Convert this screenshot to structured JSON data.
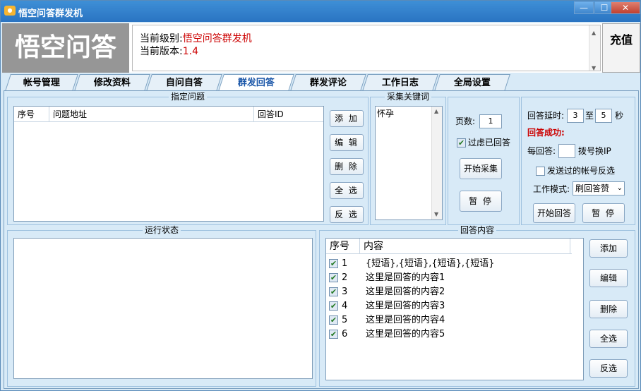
{
  "window": {
    "title": "悟空问答群发机",
    "app_icon": "app-logo-icon",
    "min": "—",
    "max": "☐",
    "close": "✕"
  },
  "header": {
    "logo_text": "悟空问答",
    "level_label": "当前级别:",
    "level_value": "悟空问答群发机",
    "version_label": "当前版本:",
    "version_value": "1.4",
    "recharge_label": "充值"
  },
  "tabs": [
    "帐号管理",
    "修改资料",
    "自问自答",
    "群发回答",
    "群发评论",
    "工作日志",
    "全局设置"
  ],
  "active_tab": "群发回答",
  "question_group": {
    "title": "指定问题",
    "columns": [
      "序号",
      "问题地址",
      "回答ID"
    ],
    "buttons": [
      "添 加",
      "编 辑",
      "删 除",
      "全 选",
      "反 选"
    ]
  },
  "keyword_group": {
    "title": "采集关键词",
    "text": "怀孕"
  },
  "collect": {
    "pages_label": "页数:",
    "pages_value": "1",
    "filter_label": "过虑已回答",
    "filter_checked": true,
    "start_label": "开始采集",
    "pause_label": "暂 停"
  },
  "settings": {
    "delay_label": "回答延时:",
    "delay_from": "3",
    "to_label": "至",
    "delay_to": "5",
    "sec_label": "秒",
    "success_label": "回答成功:",
    "per_label": "每回答:",
    "per_value": "",
    "ip_label": "拨号换IP",
    "reverse_label": "发送过的帐号反选",
    "reverse_checked": false,
    "mode_label": "工作模式:",
    "mode_value": "刷回答赞",
    "start_label": "开始回答",
    "pause_label": "暂 停"
  },
  "status_group": {
    "title": "运行状态"
  },
  "answers": {
    "title": "回答内容",
    "columns": [
      "序号",
      "内容"
    ],
    "rows": [
      {
        "no": "1",
        "text": "{短语},{短语},{短语},{短语}",
        "checked": true
      },
      {
        "no": "2",
        "text": "这里是回答的内容1",
        "checked": true
      },
      {
        "no": "3",
        "text": "这里是回答的内容2",
        "checked": true
      },
      {
        "no": "4",
        "text": "这里是回答的内容3",
        "checked": true
      },
      {
        "no": "5",
        "text": "这里是回答的内容4",
        "checked": true
      },
      {
        "no": "6",
        "text": "这里是回答的内容5",
        "checked": true
      }
    ],
    "buttons": [
      "添加",
      "编辑",
      "删除",
      "全选",
      "反选"
    ]
  },
  "colors": {
    "title_bar": "#2a74c2",
    "accent_red": "#cc0000",
    "panel_bg": "#d8eaf7",
    "active_tab_text": "#1a56a8"
  }
}
